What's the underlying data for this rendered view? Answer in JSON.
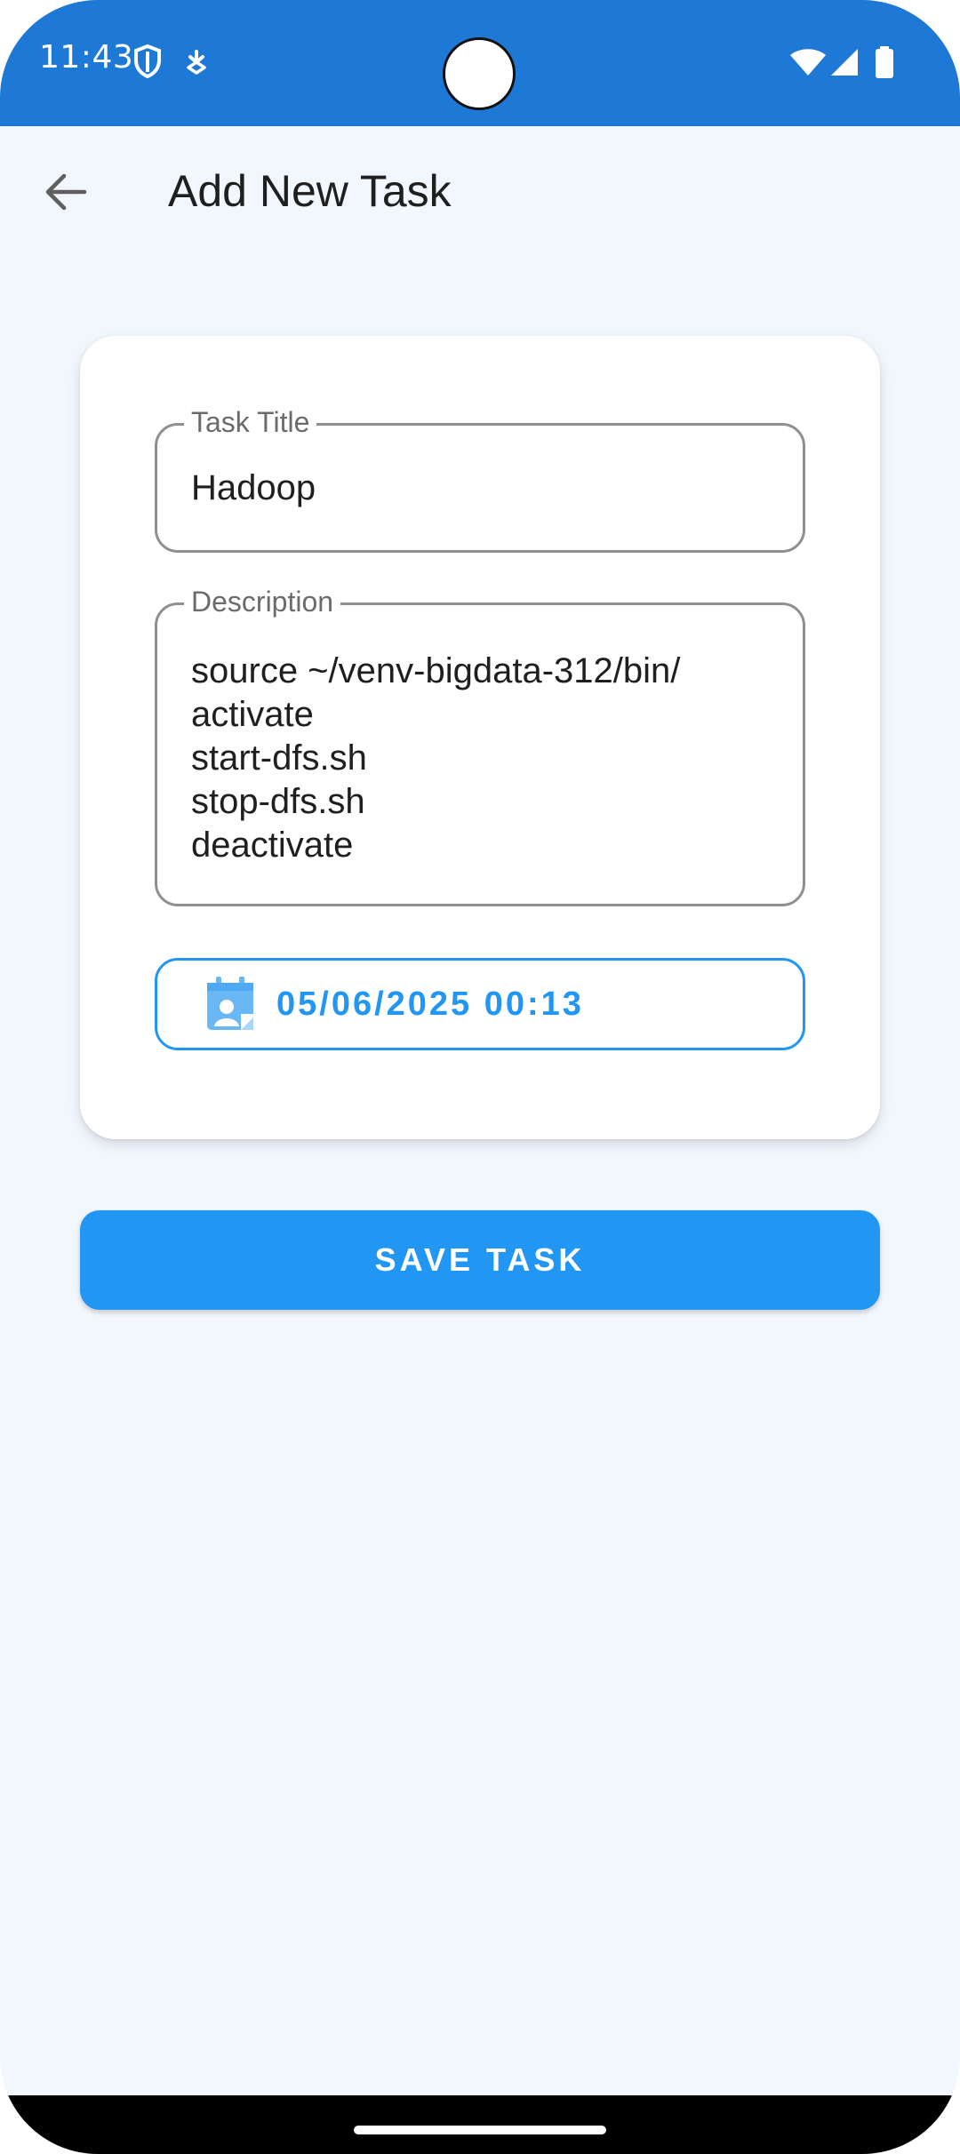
{
  "status_bar": {
    "time": "11:43",
    "left_icons": [
      "shield-icon",
      "download-notification-icon"
    ],
    "right_icons": [
      "wifi-icon",
      "cell-signal-icon",
      "battery-icon"
    ],
    "color": "#1e78d6"
  },
  "app_bar": {
    "title": "Add New Task",
    "back_icon": "arrow-back-icon"
  },
  "form": {
    "task_title": {
      "label": "Task Title",
      "value": "Hadoop"
    },
    "description": {
      "label": "Description",
      "value": "source ~/venv-bigdata-312/bin/\nactivate\nstart-dfs.sh\nstop-dfs.sh\ndeactivate"
    },
    "due_date": {
      "icon": "calendar-icon",
      "value": "05/06/2025 00:13"
    }
  },
  "save_button": {
    "label": "SAVE TASK",
    "color": "#2196f3"
  },
  "colors": {
    "accent": "#2196f3",
    "background": "#f2f6fd"
  }
}
